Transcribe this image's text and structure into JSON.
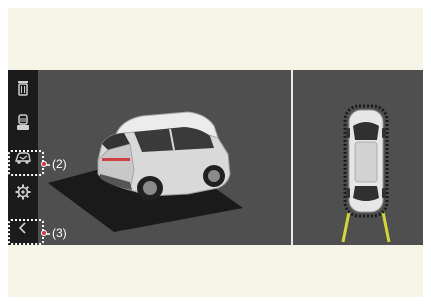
{
  "sidebar": {
    "buttons": [
      {
        "icon": "trash-can-icon"
      },
      {
        "icon": "bin-seat-icon"
      },
      {
        "icon": "car-view-icon",
        "callout": "(2)"
      },
      {
        "icon": "gear-icon"
      },
      {
        "icon": "back-chevron-icon",
        "callout": "(3)"
      }
    ]
  },
  "colors": {
    "screen_background": "#4f4f4f",
    "sidebar_background": "#1b1b1b",
    "guide_lines": "#d6d63a",
    "callout_dot": "#cf3b3b",
    "panel_background": "#f6f4e7"
  }
}
